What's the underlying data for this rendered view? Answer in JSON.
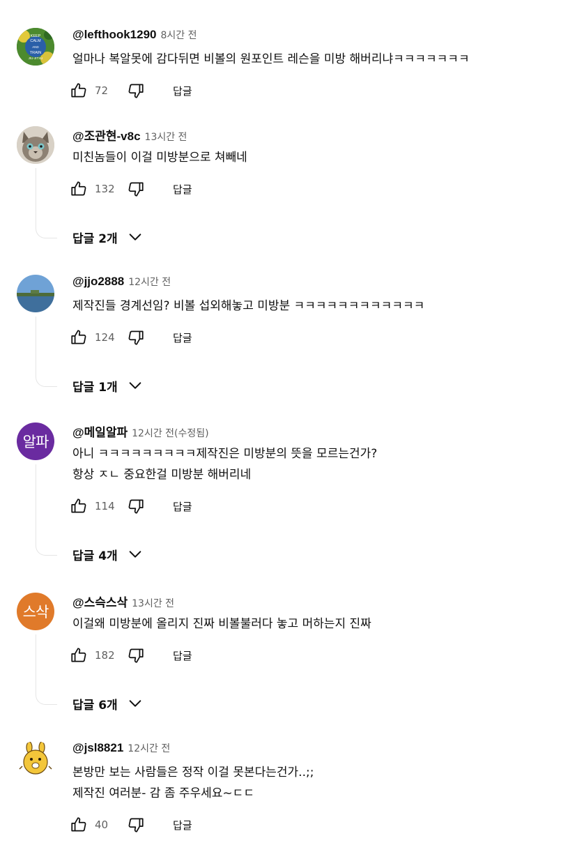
{
  "comments": [
    {
      "author": "@lefthook1290",
      "time": "8시간 전",
      "lines": [
        "얼마나 복알못에 감다뒤면 비볼의 원포인트 레슨을 미방 해버리냐ㅋㅋㅋㅋㅋㅋㅋ"
      ],
      "likes": "72",
      "reply_label": "답글",
      "avatar_text": [
        "KEEP",
        "CALM",
        "AND",
        "TRAIN",
        "JIU-JITSU"
      ],
      "avatar_color": "#3a7a2a"
    },
    {
      "author": "@조관현-v8c",
      "time": "13시간 전",
      "lines": [
        "미친놈들이 이걸 미방분으로 쳐빼네"
      ],
      "likes": "132",
      "reply_label": "답글",
      "replies_label": "답글 2개",
      "avatar_color": "#8a7f70"
    },
    {
      "author": "@jjo2888",
      "time": "12시간 전",
      "lines": [
        "제작진들 경계선임? 비볼 섭외해놓고 미방분 ㅋㅋㅋㅋㅋㅋㅋㅋㅋㅋㅋㅋ"
      ],
      "likes": "124",
      "reply_label": "답글",
      "replies_label": "답글 1개",
      "avatar_color": "#5f8fc4"
    },
    {
      "author": "@메일알파",
      "time": "12시간 전(수정됨)",
      "lines": [
        "아니 ㅋㅋㅋㅋㅋㅋㅋㅋㅋ제작진은 미방분의 뜻을 모르는건가?",
        "항상 ㅈㄴ 중요한걸 미방분 해버리네"
      ],
      "likes": "114",
      "reply_label": "답글",
      "replies_label": "답글 4개",
      "avatar_letter": "알파",
      "avatar_color": "#6a2ba0"
    },
    {
      "author": "@스슥스삭",
      "time": "13시간 전",
      "lines": [
        "이걸왜 미방분에 올리지 진짜 비볼불러다 놓고 머하는지 진짜"
      ],
      "likes": "182",
      "reply_label": "답글",
      "replies_label": "답글 6개",
      "avatar_letter": "스삭",
      "avatar_color": "#e07a2a"
    },
    {
      "author": "@jsl8821",
      "time": "12시간 전",
      "lines": [
        "본방만 보는 사람들은 정작 이걸 못본다는건가..;;",
        "제작진 여러분- 감 좀 주우세요~ㄷㄷ"
      ],
      "likes": "40",
      "reply_label": "답글",
      "avatar_color": "#f3c63a"
    }
  ]
}
